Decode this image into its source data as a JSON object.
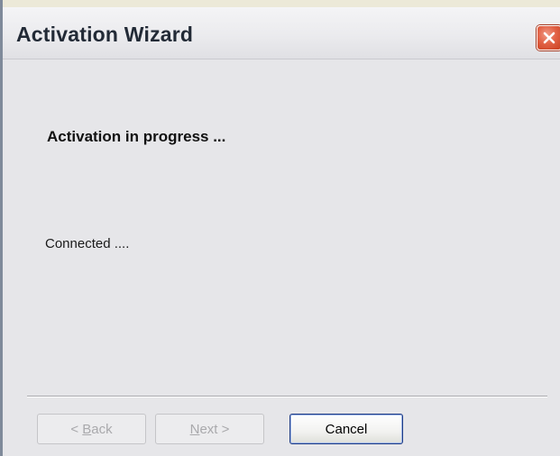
{
  "window": {
    "title": "Activation Wizard",
    "close_icon": "close-icon"
  },
  "main": {
    "heading": "Activation in progress ...",
    "status": "Connected  ...."
  },
  "buttons": {
    "back": {
      "prefix": "< ",
      "accel": "B",
      "rest": "ack",
      "enabled": false
    },
    "next": {
      "accel": "N",
      "rest": "ext >",
      "enabled": false
    },
    "cancel": {
      "label": "Cancel",
      "enabled": true
    }
  },
  "colors": {
    "close_button": "#e26246",
    "cancel_border": "#1e3c86",
    "disabled_text": "#a9a9ac"
  }
}
